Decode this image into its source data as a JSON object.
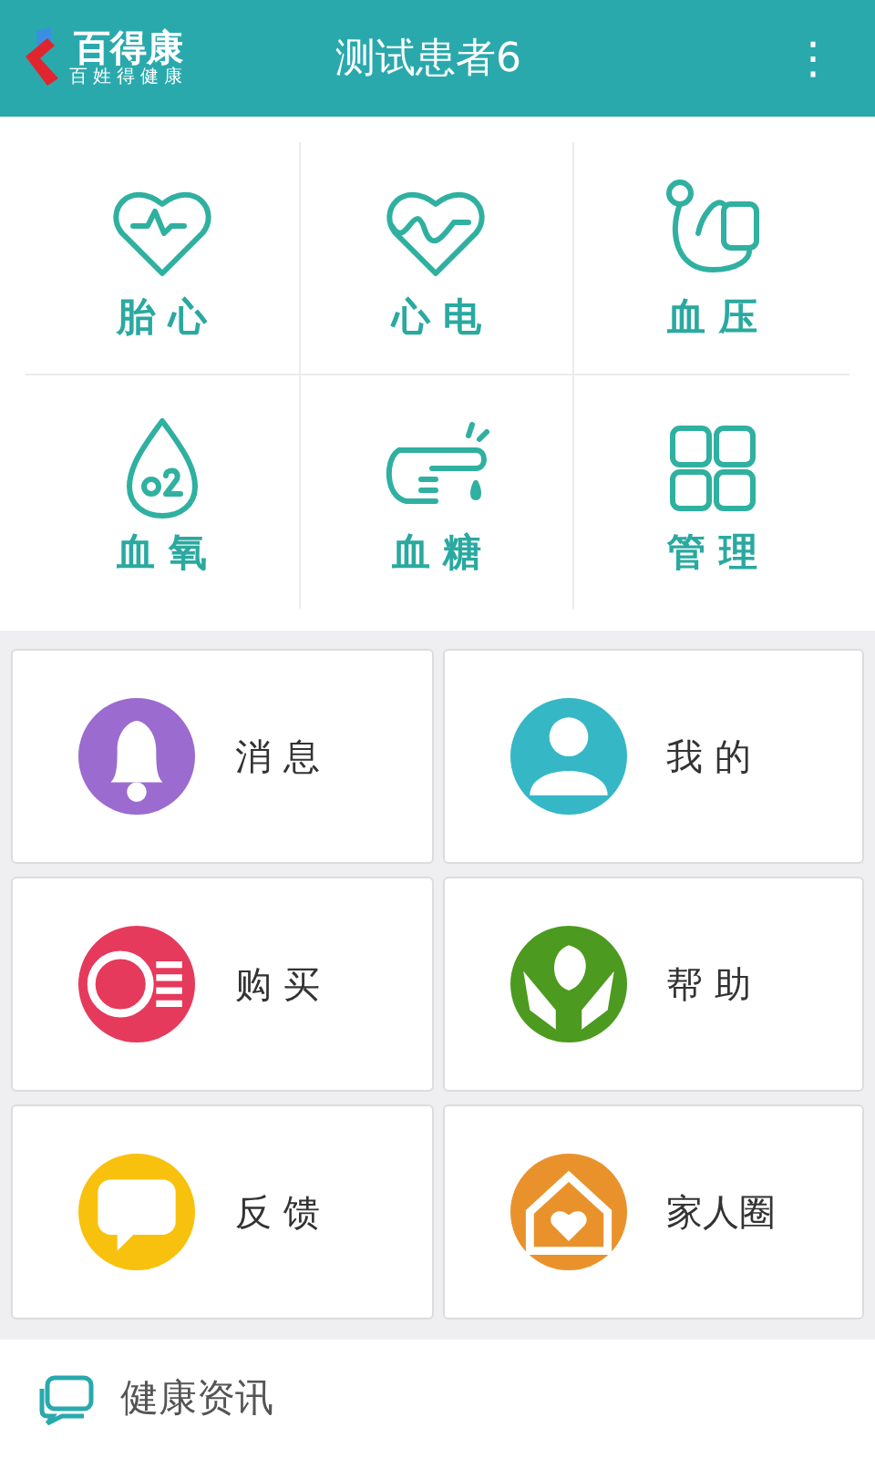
{
  "header": {
    "logo_name": "百得康",
    "logo_slogan": "百姓得健康",
    "title": "测试患者6",
    "menu": "⋮"
  },
  "measures": [
    {
      "label": "胎 心"
    },
    {
      "label": "心 电"
    },
    {
      "label": "血 压"
    },
    {
      "label": "血 氧"
    },
    {
      "label": "血 糖"
    },
    {
      "label": "管 理"
    }
  ],
  "tiles": [
    {
      "label": "消 息",
      "color": "#9b6bd0"
    },
    {
      "label": "我 的",
      "color": "#35b7c6"
    },
    {
      "label": "购 买",
      "color": "#e53a5c"
    },
    {
      "label": "帮 助",
      "color": "#4c9a1f"
    },
    {
      "label": "反 馈",
      "color": "#f8c10d"
    },
    {
      "label": "家人圈",
      "color": "#e9922c"
    }
  ],
  "news": {
    "label": "健康资讯"
  }
}
